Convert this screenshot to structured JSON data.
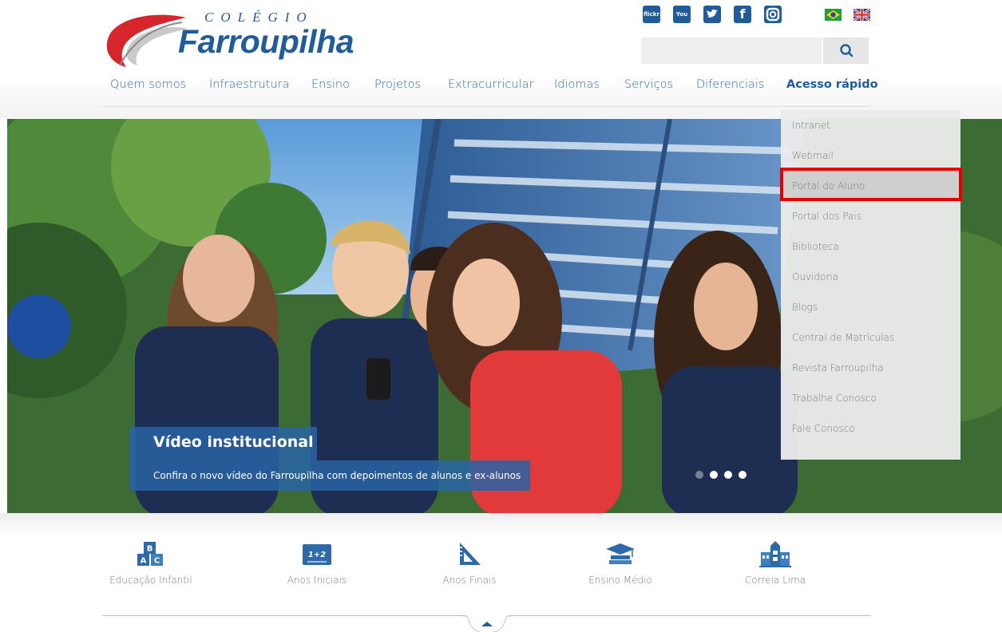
{
  "logo": {
    "top": "COLÉGIO",
    "main": "Farroupilha"
  },
  "social": [
    {
      "icon": "flickr-icon",
      "glyph": "flickr"
    },
    {
      "icon": "youtube-icon",
      "glyph": "You Tube"
    },
    {
      "icon": "twitter-icon",
      "glyph": "t"
    },
    {
      "icon": "facebook-icon",
      "glyph": "f"
    },
    {
      "icon": "instagram-icon",
      "glyph": "◘"
    }
  ],
  "languages": [
    {
      "icon": "brazil-flag-icon"
    },
    {
      "icon": "uk-flag-icon"
    }
  ],
  "search": {
    "placeholder": "",
    "button_icon": "search-icon"
  },
  "nav": [
    {
      "label": "Quem somos"
    },
    {
      "label": "Infraestrutura"
    },
    {
      "label": "Ensino"
    },
    {
      "label": "Projetos"
    },
    {
      "label": "Extracurricular"
    },
    {
      "label": "Idiomas"
    },
    {
      "label": "Serviços"
    },
    {
      "label": "Diferenciais"
    },
    {
      "label": "Acesso rápido",
      "active": true
    }
  ],
  "dropdown": [
    {
      "label": "Intranet"
    },
    {
      "label": "Webmail"
    },
    {
      "label": "Portal do Aluno",
      "highlighted": true
    },
    {
      "label": "Portal dos Pais"
    },
    {
      "label": "Biblioteca"
    },
    {
      "label": "Ouvidoria"
    },
    {
      "label": "Blogs"
    },
    {
      "label": "Central de Matrículas"
    },
    {
      "label": "Revista Farroupilha"
    },
    {
      "label": "Trabalhe Conosco"
    },
    {
      "label": "Fale Conosco"
    }
  ],
  "hero": {
    "title": "Vídeo institucional",
    "text": "Confira o novo vídeo do Farroupilha com depoimentos de alunos e ex-alunos",
    "slides": 4,
    "active_slide": 1
  },
  "segments": [
    {
      "label": "Educação Infantil",
      "icon": "abc-blocks-icon"
    },
    {
      "label": "Anos Iniciais",
      "icon": "chalkboard-icon"
    },
    {
      "label": "Anos Finais",
      "icon": "ruler-triangle-icon"
    },
    {
      "label": "Ensino Médio",
      "icon": "graduation-cap-icon"
    },
    {
      "label": "Correia Lima",
      "icon": "building-icon"
    }
  ],
  "colors": {
    "brand": "#1f5c99",
    "highlight": "#e60000"
  }
}
